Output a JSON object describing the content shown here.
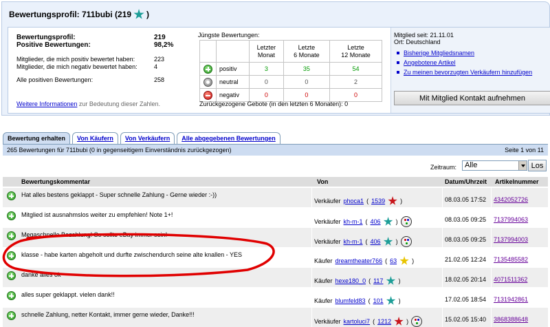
{
  "profile": {
    "title": "Bewertungsprofil: 711bubi (219",
    "title_close": ")",
    "stats": [
      {
        "label": "Bewertungsprofil:",
        "value": "219"
      },
      {
        "label": "Positive Bewertungen:",
        "value": "98,2%"
      }
    ],
    "stats_small": [
      {
        "label": "Mitglieder, die mich positiv bewertet haben:",
        "value": "223"
      },
      {
        "label": "Mitglieder, die mich negativ bewertet haben:",
        "value": "4"
      },
      {
        "label": "Alle positiven Bewertungen:",
        "value": "258"
      }
    ],
    "more_info_link": "Weitere Informationen",
    "more_info_rest": " zur Bedeutung dieser Zahlen."
  },
  "recent": {
    "title": "Jüngste Bewertungen:",
    "col1_a": "Letzter",
    "col1_b": "Monat",
    "col2_a": "Letzte",
    "col2_b": "6 Monate",
    "col3_a": "Letzte",
    "col3_b": "12 Monate",
    "rows": [
      {
        "label": "positiv",
        "v": [
          "3",
          "35",
          "54"
        ]
      },
      {
        "label": "neutral",
        "v": [
          "0",
          "0",
          "2"
        ]
      },
      {
        "label": "negativ",
        "v": [
          "0",
          "0",
          "0"
        ]
      }
    ],
    "retracted": "Zurückgezogene Gebote (in den letzten 6 Monaten): 0"
  },
  "member": {
    "since": "Mitglied seit: 21.11.01",
    "location": "Ort: Deutschland",
    "links": [
      "Bisherige Mitgliedsnamen",
      "Angebotene Artikel",
      "Zu meinen bevorzugten Verkäufern hinzufügen"
    ],
    "contact_button": "Mit Mitglied Kontakt aufnehmen"
  },
  "tabs": [
    "Bewertung erhalten",
    "Von Käufern",
    "Von Verkäufern",
    "Alle abgegebenen Bewertungen"
  ],
  "summary": "265 Bewertungen für 711bubi (0 in gegenseitigem Einverständnis zurückgezogen)",
  "page_info": "Seite 1 von 11",
  "filter": {
    "label": "Zeitraum:",
    "selected": "Alle",
    "button": "Los"
  },
  "columns": {
    "comment": "Bewertungskommentar",
    "from": "Von",
    "date": "Datum/Uhrzeit",
    "item": "Artikelnummer"
  },
  "feedback": [
    {
      "comment": "Hat alles bestens geklappt - Super schnelle Zahlung - Gerne wieder :-))",
      "role": "Verkäufer",
      "user": "phoca1",
      "score": "1539",
      "star": "red",
      "me": false,
      "date": "08.03.05 17:52",
      "item": "4342052726"
    },
    {
      "comment": "Mitglied ist ausnahmslos weiter zu empfehlen! Note 1+!",
      "role": "Verkäufer",
      "user": "kh-m-1",
      "score": "406",
      "star": "teal",
      "me": true,
      "date": "08.03.05 09:25",
      "item": "7137994063"
    },
    {
      "comment": "Megaschnelle Bezahlung! So sollte eBay immer sein!",
      "role": "Verkäufer",
      "user": "kh-m-1",
      "score": "406",
      "star": "teal",
      "me": true,
      "date": "08.03.05 09:25",
      "item": "7137994003"
    },
    {
      "comment": "klasse - habe karten abgeholt und durfte zwischendurch seine alte knallen - YES",
      "role": "Käufer",
      "user": "dreamtheater766",
      "score": "63",
      "star": "yellow",
      "me": false,
      "date": "21.02.05 12:24",
      "item": "7135485582"
    },
    {
      "comment": "danke alles ok",
      "role": "Käufer",
      "user": "hexe180_0",
      "score": "117",
      "star": "teal",
      "me": false,
      "date": "18.02.05 20:14",
      "item": "4071511362"
    },
    {
      "comment": "alles super geklappt. vielen dank!!",
      "role": "Käufer",
      "user": "blumfeld83",
      "score": "101",
      "star": "teal",
      "me": false,
      "date": "17.02.05 18:54",
      "item": "7131942861"
    },
    {
      "comment": "schnelle Zahlung, netter Kontakt, immer gerne wieder, Danke!!!",
      "role": "Verkäufer",
      "user": "kartoluci7",
      "score": "1212",
      "star": "red",
      "me": true,
      "date": "15.02.05 15:40",
      "item": "3868388648"
    }
  ],
  "colors": {
    "header_bg": "#eaf1fb",
    "tab_active": "#d0def2",
    "summary_bar": "#cddcf1",
    "highlight": "#e00000"
  }
}
